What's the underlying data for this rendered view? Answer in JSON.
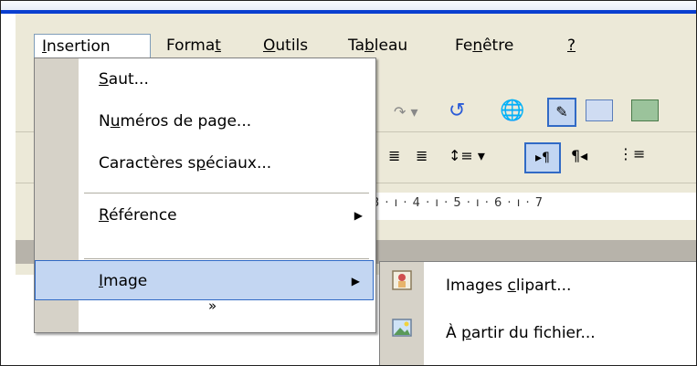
{
  "menubar": {
    "items": [
      {
        "label": "Insertion",
        "u": "I"
      },
      {
        "label": "Format",
        "u": "t"
      },
      {
        "label": "Outils",
        "u": "O"
      },
      {
        "label": "Tableau",
        "u": "b"
      },
      {
        "label": "Fenêtre",
        "u": "n"
      },
      {
        "label": "?",
        "u": "?"
      }
    ]
  },
  "dropdown": {
    "items": [
      {
        "label": "Saut..."
      },
      {
        "label": "Numéros de page..."
      },
      {
        "label": "Caractères spéciaux..."
      },
      {
        "label": "Référence",
        "has_submenu": true
      },
      {
        "label": "Image",
        "has_submenu": true,
        "selected": true
      }
    ],
    "more_chevron": "»"
  },
  "submenu": {
    "items": [
      {
        "label": "Images clipart...",
        "icon": "clipart-icon"
      },
      {
        "label": "À partir du fichier...",
        "icon": "picture-file-icon"
      }
    ]
  },
  "ruler": {
    "text": "3 · ı · 4 · ı · 5 · ı · 6 · ı · 7"
  },
  "colors": {
    "accent": "#316ac5",
    "selection": "#c3d6f2",
    "menu_bg": "#ece9d8",
    "titlebar": "#0a3fd0"
  }
}
